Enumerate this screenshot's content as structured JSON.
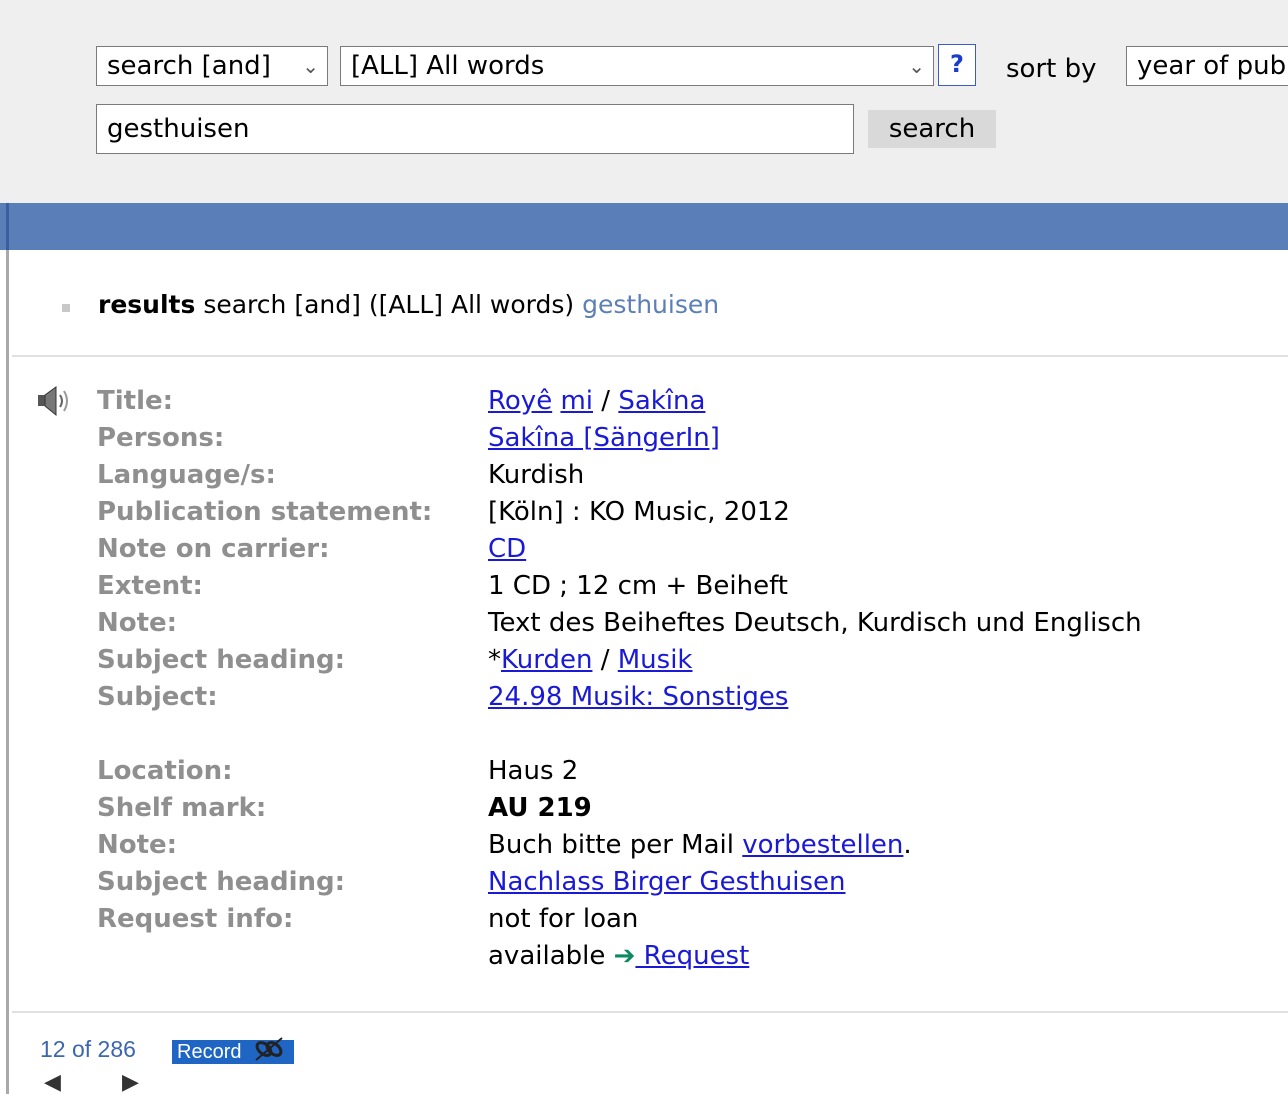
{
  "search": {
    "mode_select": "search [and]",
    "field_select": "[ALL] All words",
    "help_label": "?",
    "sort_label": "sort by",
    "sort_select": "year of pub",
    "query": "gesthuisen",
    "button": "search"
  },
  "results_header": {
    "bold": "results",
    "mode": "search [and]",
    "field": "([ALL] All words)",
    "query": "gesthuisen"
  },
  "record": {
    "title_label": "Title:",
    "title_parts": [
      "Royê",
      "mi",
      "/",
      "Sakîna"
    ],
    "persons_label": "Persons:",
    "persons": "Sakîna [SängerIn]",
    "language_label": "Language/s:",
    "language": "Kurdish",
    "publication_label": "Publication statement:",
    "publication": "[Köln] : KO Music, 2012",
    "carrier_label": "Note on carrier:",
    "carrier": "CD",
    "extent_label": "Extent:",
    "extent": "1 CD ; 12 cm + Beiheft",
    "note_label": "Note:",
    "note": "Text des Beiheftes Deutsch, Kurdisch und Englisch",
    "subject_heading_label": "Subject heading:",
    "subject_heading_prefix": "*",
    "subject_heading_parts": [
      "Kurden",
      "/",
      "Musik"
    ],
    "subject_label": "Subject:",
    "subject": "24.98 Musik: Sonstiges"
  },
  "holding": {
    "location_label": "Location:",
    "location": "Haus 2",
    "shelf_label": "Shelf mark:",
    "shelf": "AU 219",
    "note_label": "Note:",
    "note_prefix": "Buch bitte per Mail ",
    "note_link": "vorbestellen",
    "note_suffix": ".",
    "subject_heading_label": "Subject heading:",
    "subject_heading": "Nachlass Birger Gesthuisen",
    "request_label": "Request info:",
    "request_status": "not for loan",
    "availability": "available",
    "request_link": " Request"
  },
  "pager": {
    "position": "12 of 286",
    "record_button": "Record"
  }
}
